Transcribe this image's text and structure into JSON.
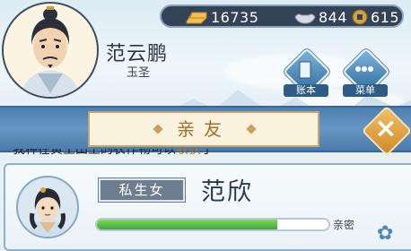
{
  "player": {
    "name": "范云鹏",
    "title": "玉圣"
  },
  "currencies": [
    {
      "icon": "gold-ingot-icon",
      "value": "16735"
    },
    {
      "icon": "silver-ingot-icon",
      "value": "844"
    },
    {
      "icon": "copper-coin-icon",
      "value": "615"
    }
  ],
  "menu": {
    "ledger_label": "账本",
    "menu_label": "菜单"
  },
  "tab": {
    "title": "亲友"
  },
  "cut_text": {
    "prefix": "我种在黄土田上的农作物可以",
    "highlight": "收获",
    "suffix": "了"
  },
  "relative": {
    "relation": "私生女",
    "name": "范欣",
    "intimacy_label": "亲密",
    "intimacy_fraction": 0.78
  },
  "colors": {
    "accent": "#4d7fb0",
    "gold": "#c7a66e",
    "bar": "#4fb640"
  }
}
